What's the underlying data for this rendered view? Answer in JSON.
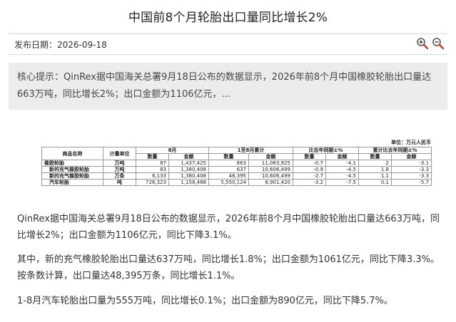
{
  "page": {
    "title": "中国前8个月轮胎出口量同比增长2%",
    "date_label": "发布日期：2026-09-18",
    "zoom_in_icon": "zoom-in-icon",
    "zoom_out_icon": "zoom-out-icon",
    "summary": "核心提示：QinRex据中国海关总署9月18日公布的数据显示，2026年前8个月中国橡胶轮胎出口量达663万吨，同比增长2%；出口金额为1106亿元，..."
  },
  "table": {
    "unit_note": "单位：万元人民币",
    "headers": {
      "product": "商品名称",
      "unit": "计量单位",
      "aug": "8月",
      "ytd": "1至8月累计",
      "yoy": "比去年同期±%",
      "cum_yoy": "累计比去年同期±%",
      "qty": "数量",
      "amount": "金额"
    },
    "rows": [
      {
        "name": "橡胶轮胎",
        "unit": "万吨",
        "aug_qty": "87",
        "aug_amt": "1,437,425",
        "ytd_qty": "663",
        "ytd_amt": "11,063,925",
        "yoy_qty": "-0.7",
        "yoy_amt": "-4.1",
        "cum_qty": "2",
        "cum_amt": "-3.1",
        "indent": false
      },
      {
        "name": "新的充气橡胶轮胎",
        "unit": "万吨",
        "aug_qty": "83",
        "aug_amt": "1,380,408",
        "ytd_qty": "637",
        "ytd_amt": "10,606,499",
        "yoy_qty": "-0.9",
        "yoy_amt": "-4.5",
        "cum_qty": "1.8",
        "cum_amt": "-3.3",
        "indent": true
      },
      {
        "name": "新的充气橡胶轮胎",
        "unit": "万条",
        "aug_qty": "6,133",
        "aug_amt": "1,380,408",
        "ytd_qty": "48,395",
        "ytd_amt": "10,606,499",
        "yoy_qty": "-2.7",
        "yoy_amt": "-4.5",
        "cum_qty": "1.1",
        "cum_amt": "-3.3",
        "indent": true
      },
      {
        "name": "汽车轮胎",
        "unit": "吨",
        "aug_qty": "726,323",
        "aug_amt": "1,158,488",
        "ytd_qty": "5,550,124",
        "ytd_amt": "8,901,420",
        "yoy_qty": "-3.2",
        "yoy_amt": "-7.5",
        "cum_qty": "0.1",
        "cum_amt": "-5.7",
        "indent": true
      }
    ]
  },
  "paragraphs": [
    "QinRex据中国海关总署9月18日公布的数据显示，2026年前8个月中国橡胶轮胎出口量达663万吨，同比增长2%；出口金额为1106亿元，同比下降3.1%。",
    "其中，新的充气橡胶轮胎出口量达637万吨，同比增长1.8%；出口金额为1061亿元，同比下降3.3%。按条数计算，出口量达48,395万条，同比增长1.1%。",
    "1-8月汽车轮胎出口量为555万吨，同比增长0.1%；出口金额为890亿元，同比下降5.7%。"
  ]
}
